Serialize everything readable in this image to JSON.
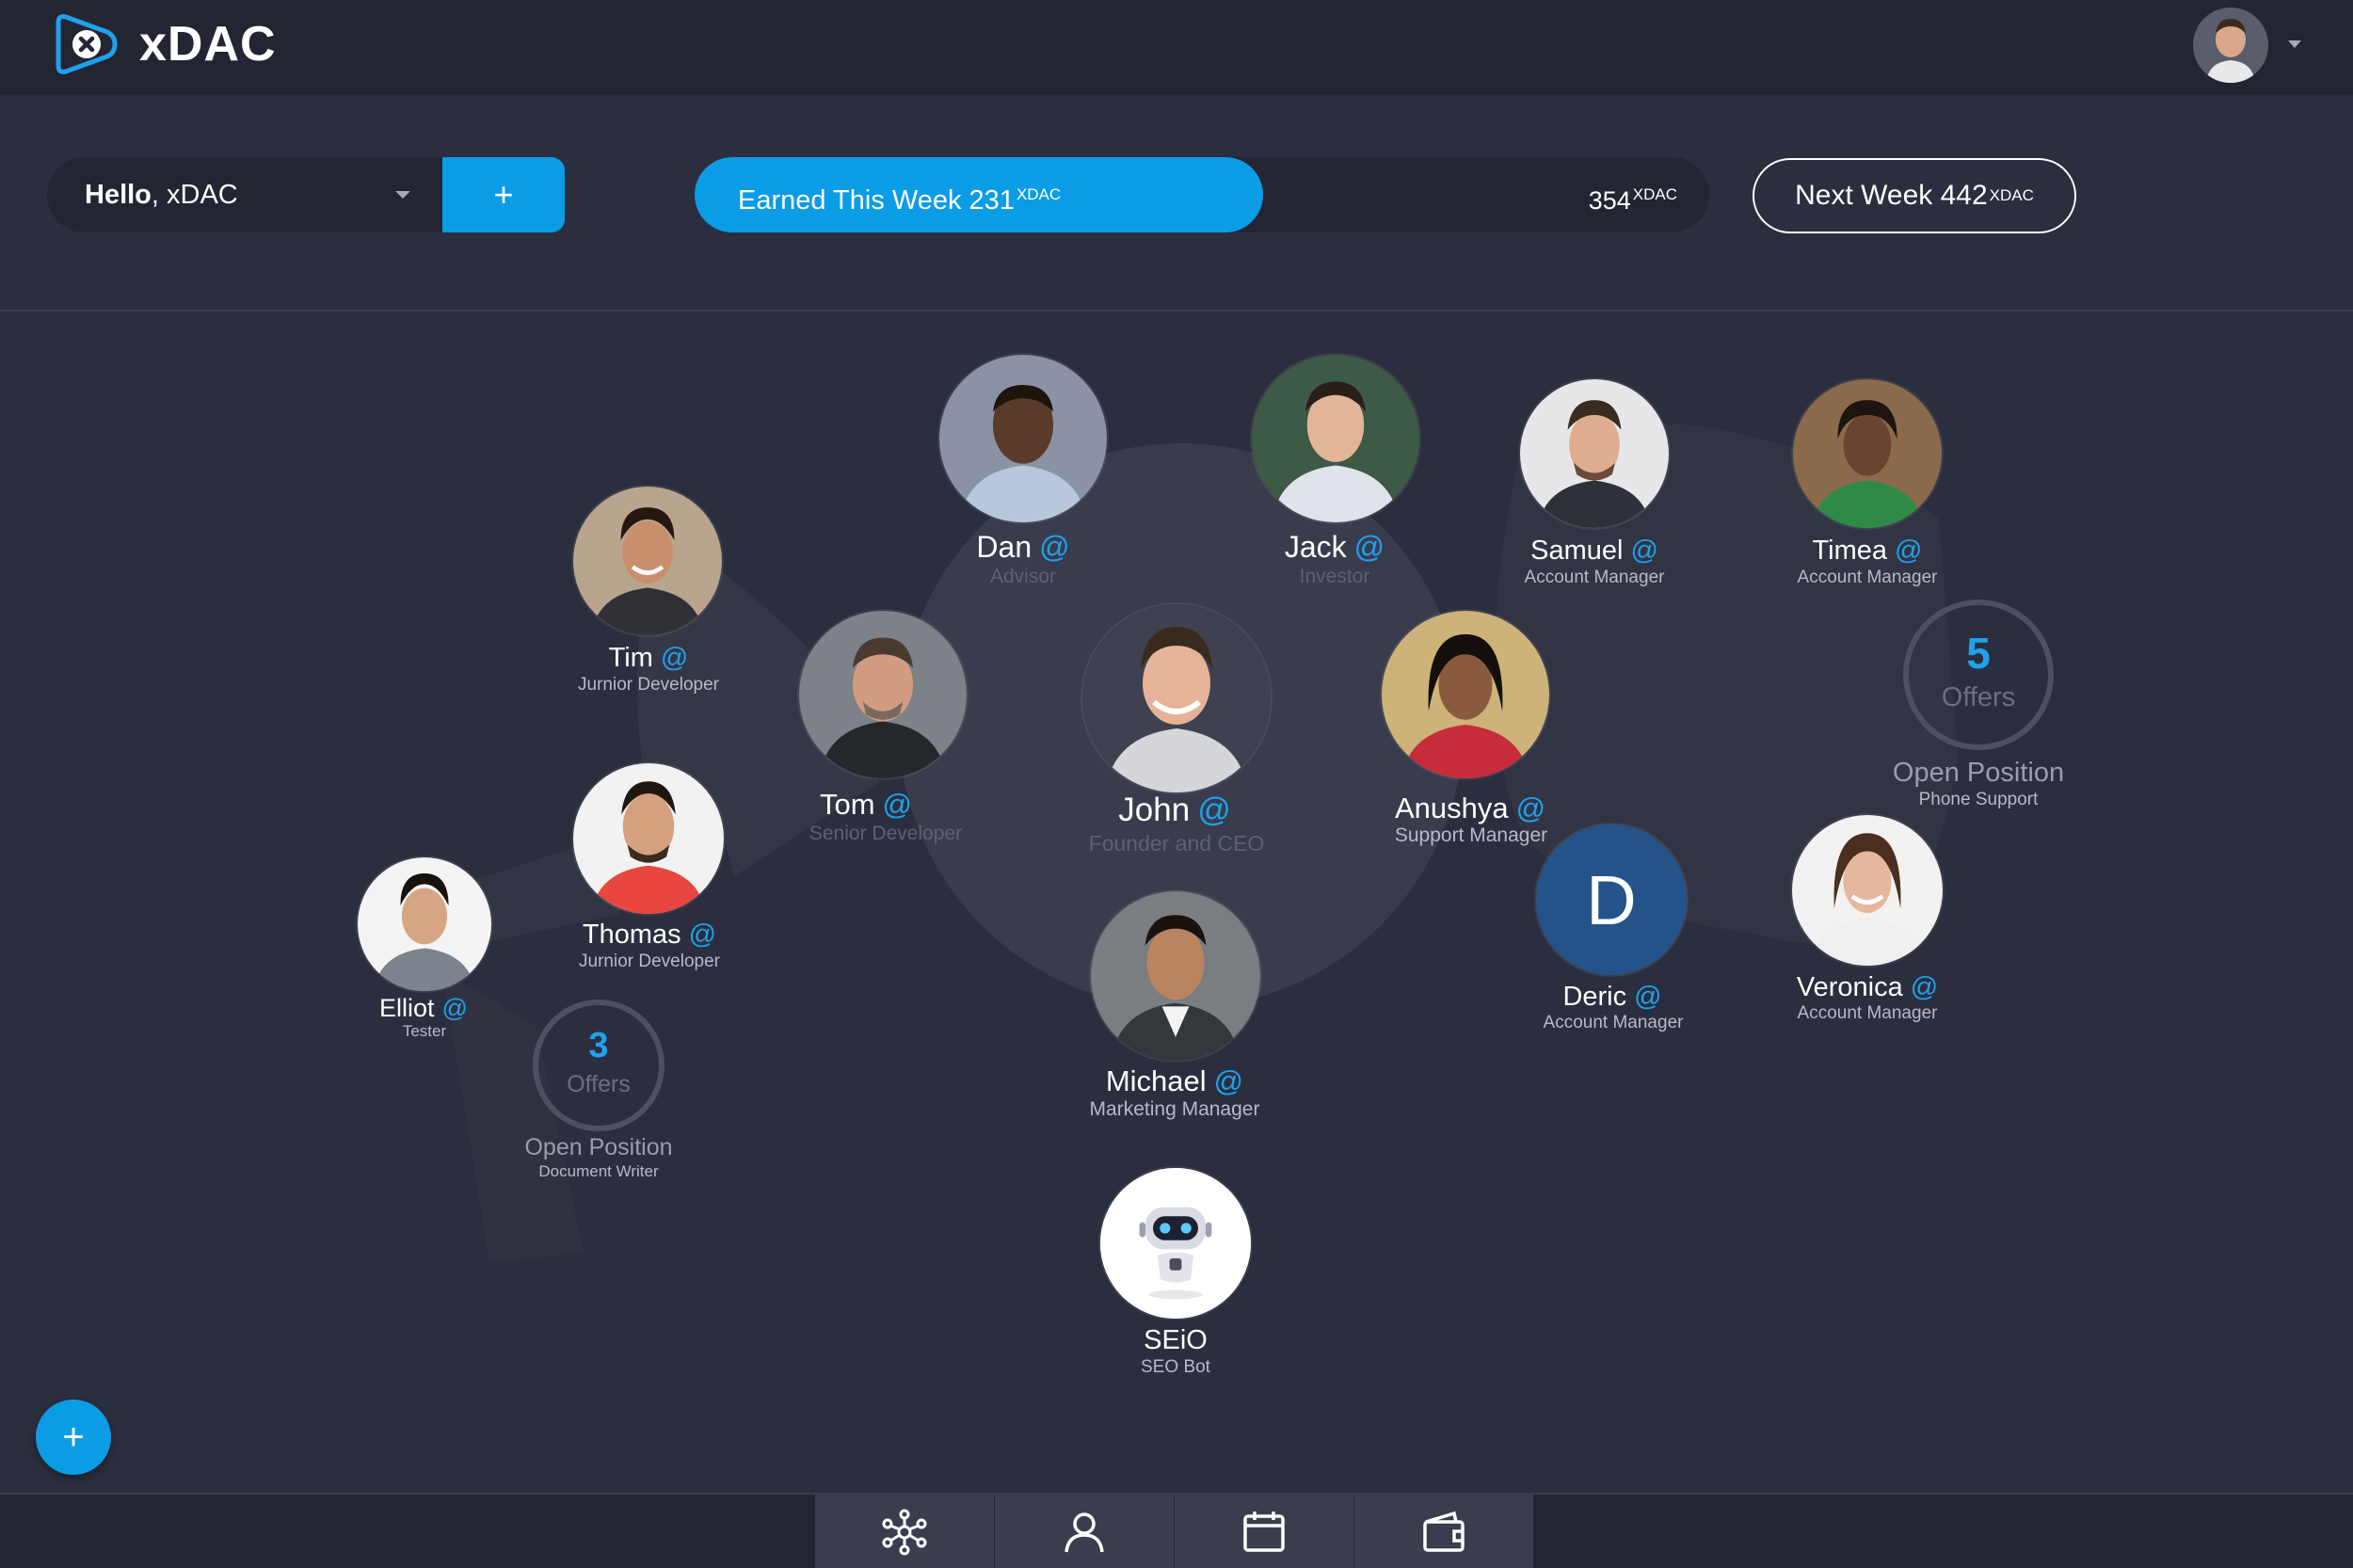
{
  "app": {
    "brand": "xDAC",
    "accent_color": "#0b9ce6"
  },
  "header": {
    "user_menu_icon": "user-avatar-icon",
    "caret_icon": "chevron-down-icon"
  },
  "toolbar": {
    "greeting_bold": "Hello",
    "greeting_rest": ", xDAC",
    "add_label": "+",
    "earned_label": "Earned This Week 231",
    "earned_unit": "XDAC",
    "earned_progress": 0.56,
    "target_value": "354",
    "target_unit": "XDAC",
    "next_week_label": "Next Week 442",
    "next_week_unit": "XDAC"
  },
  "people": {
    "dan": {
      "name": "Dan",
      "role": "Advisor"
    },
    "jack": {
      "name": "Jack",
      "role": "Investor"
    },
    "samuel": {
      "name": "Samuel",
      "role": "Account Manager"
    },
    "timea": {
      "name": "Timea",
      "role": "Account Manager"
    },
    "tim": {
      "name": "Tim",
      "role": "Jurnior Developer"
    },
    "tom": {
      "name": "Tom",
      "role": "Senior Developer"
    },
    "john": {
      "name": "John",
      "role": "Founder and CEO"
    },
    "anushya": {
      "name": "Anushya",
      "role": "Support Manager"
    },
    "thomas": {
      "name": "Thomas",
      "role": "Jurnior Developer"
    },
    "elliot": {
      "name": "Elliot",
      "role": "Tester"
    },
    "deric": {
      "name": "Deric",
      "role": "Account Manager",
      "initial": "D"
    },
    "veronica": {
      "name": "Veronica",
      "role": "Account Manager"
    },
    "michael": {
      "name": "Michael",
      "role": "Marketing Manager"
    },
    "seio": {
      "name": "SEiO",
      "role": "SEO Bot"
    }
  },
  "mention_symbol": "@",
  "open_positions": {
    "phone_support": {
      "count": "5",
      "offers_label": "Offers",
      "title": "Open Position",
      "subtitle": "Phone Support"
    },
    "document_writer": {
      "count": "3",
      "offers_label": "Offers",
      "title": "Open Position",
      "subtitle": "Document Writer"
    }
  },
  "fab": {
    "label": "+"
  },
  "bottom_nav": {
    "tabs": [
      "network-icon",
      "profile-icon",
      "calendar-icon",
      "wallet-icon"
    ]
  }
}
